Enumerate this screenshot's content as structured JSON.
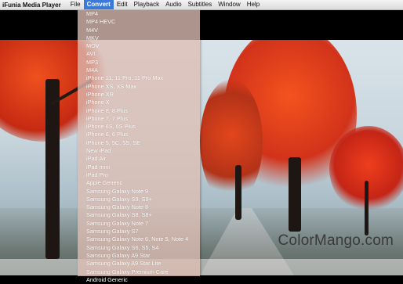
{
  "menubar": {
    "app_name": "iFunia Media Player",
    "items": [
      "File",
      "Convert",
      "Edit",
      "Playback",
      "Audio",
      "Subtitles",
      "Window",
      "Help"
    ],
    "active_item": "Convert"
  },
  "convert_menu": {
    "items": [
      "MP4",
      "MP4 HEVC",
      "M4V",
      "MKV",
      "MOV",
      "AVI",
      "MP3",
      "M4A",
      "iPhone 11, 11 Pro, 11 Pro Max",
      "iPhone XS, XS Max",
      "iPhone XR",
      "iPhone X",
      "iPhone 8, 8 Plus",
      "iPhone 7, 7 Plus",
      "iPhone 6S, 6S Plus",
      "iPhone 6, 6 Plus",
      "iPhone 5, 5C, 5S, SE",
      "New iPad",
      "iPad Air",
      "iPad mini",
      "iPad Pro",
      "Apple Generic",
      "Samsung Galaxy Note 9",
      "Samsung Galaxy S9, S9+",
      "Samsung Galaxy Note 8",
      "Samsung Galaxy S8, S8+",
      "Samsung Galaxy Note 7",
      "Samsung Galaxy S7",
      "Samsung Galaxy Note 6, Note 5, Note 4",
      "Samsung Galaxy S6, S5, S4",
      "Samsung Galaxy A9 Star",
      "Samsung Galaxy A9 Star Lite",
      "Samsung Galaxy Premium Care",
      "Android Generic"
    ]
  },
  "watermark": {
    "text": "ColorMango.com"
  },
  "colors": {
    "accent": "#3c78d8",
    "foliage": "#e0361a",
    "menu_tint": "#debeb4"
  }
}
